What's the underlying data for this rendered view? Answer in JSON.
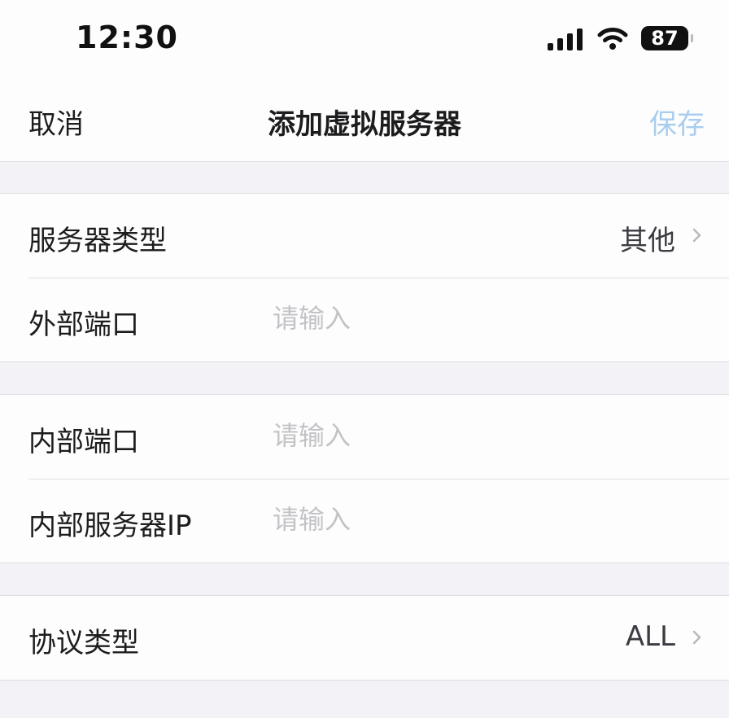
{
  "status_bar": {
    "time": "12:30",
    "battery": "87",
    "icons": [
      "signal-icon",
      "wifi-icon",
      "battery-icon"
    ]
  },
  "nav": {
    "cancel_label": "取消",
    "title": "添加虚拟服务器",
    "save_label": "保存",
    "save_color": "#a9cdef"
  },
  "group1": {
    "server_type": {
      "label": "服务器类型",
      "value": "其他"
    },
    "external_port": {
      "label": "外部端口",
      "placeholder": "请输入"
    }
  },
  "group2": {
    "internal_port": {
      "label": "内部端口",
      "placeholder": "请输入"
    },
    "internal_ip": {
      "label": "内部服务器IP",
      "placeholder": "请输入"
    }
  },
  "group3": {
    "protocol_type": {
      "label": "协议类型",
      "value": "ALL"
    }
  },
  "colors": {
    "background": "#f2f2f7",
    "cell": "#fdfdfd",
    "placeholder": "#c3c3c7",
    "chevron": "#b8b8bd"
  }
}
